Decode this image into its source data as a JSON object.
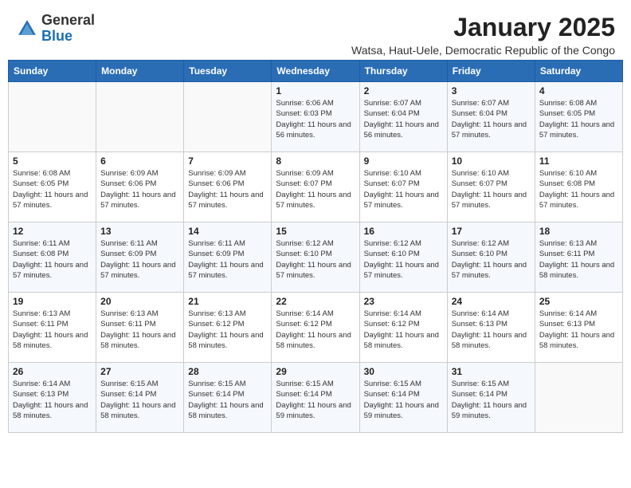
{
  "header": {
    "logo_general": "General",
    "logo_blue": "Blue",
    "title": "January 2025",
    "subtitle": "Watsa, Haut-Uele, Democratic Republic of the Congo"
  },
  "weekdays": [
    "Sunday",
    "Monday",
    "Tuesday",
    "Wednesday",
    "Thursday",
    "Friday",
    "Saturday"
  ],
  "weeks": [
    [
      {
        "day": "",
        "info": ""
      },
      {
        "day": "",
        "info": ""
      },
      {
        "day": "",
        "info": ""
      },
      {
        "day": "1",
        "info": "Sunrise: 6:06 AM\nSunset: 6:03 PM\nDaylight: 11 hours and 56 minutes."
      },
      {
        "day": "2",
        "info": "Sunrise: 6:07 AM\nSunset: 6:04 PM\nDaylight: 11 hours and 56 minutes."
      },
      {
        "day": "3",
        "info": "Sunrise: 6:07 AM\nSunset: 6:04 PM\nDaylight: 11 hours and 57 minutes."
      },
      {
        "day": "4",
        "info": "Sunrise: 6:08 AM\nSunset: 6:05 PM\nDaylight: 11 hours and 57 minutes."
      }
    ],
    [
      {
        "day": "5",
        "info": "Sunrise: 6:08 AM\nSunset: 6:05 PM\nDaylight: 11 hours and 57 minutes."
      },
      {
        "day": "6",
        "info": "Sunrise: 6:09 AM\nSunset: 6:06 PM\nDaylight: 11 hours and 57 minutes."
      },
      {
        "day": "7",
        "info": "Sunrise: 6:09 AM\nSunset: 6:06 PM\nDaylight: 11 hours and 57 minutes."
      },
      {
        "day": "8",
        "info": "Sunrise: 6:09 AM\nSunset: 6:07 PM\nDaylight: 11 hours and 57 minutes."
      },
      {
        "day": "9",
        "info": "Sunrise: 6:10 AM\nSunset: 6:07 PM\nDaylight: 11 hours and 57 minutes."
      },
      {
        "day": "10",
        "info": "Sunrise: 6:10 AM\nSunset: 6:07 PM\nDaylight: 11 hours and 57 minutes."
      },
      {
        "day": "11",
        "info": "Sunrise: 6:10 AM\nSunset: 6:08 PM\nDaylight: 11 hours and 57 minutes."
      }
    ],
    [
      {
        "day": "12",
        "info": "Sunrise: 6:11 AM\nSunset: 6:08 PM\nDaylight: 11 hours and 57 minutes."
      },
      {
        "day": "13",
        "info": "Sunrise: 6:11 AM\nSunset: 6:09 PM\nDaylight: 11 hours and 57 minutes."
      },
      {
        "day": "14",
        "info": "Sunrise: 6:11 AM\nSunset: 6:09 PM\nDaylight: 11 hours and 57 minutes."
      },
      {
        "day": "15",
        "info": "Sunrise: 6:12 AM\nSunset: 6:10 PM\nDaylight: 11 hours and 57 minutes."
      },
      {
        "day": "16",
        "info": "Sunrise: 6:12 AM\nSunset: 6:10 PM\nDaylight: 11 hours and 57 minutes."
      },
      {
        "day": "17",
        "info": "Sunrise: 6:12 AM\nSunset: 6:10 PM\nDaylight: 11 hours and 57 minutes."
      },
      {
        "day": "18",
        "info": "Sunrise: 6:13 AM\nSunset: 6:11 PM\nDaylight: 11 hours and 58 minutes."
      }
    ],
    [
      {
        "day": "19",
        "info": "Sunrise: 6:13 AM\nSunset: 6:11 PM\nDaylight: 11 hours and 58 minutes."
      },
      {
        "day": "20",
        "info": "Sunrise: 6:13 AM\nSunset: 6:11 PM\nDaylight: 11 hours and 58 minutes."
      },
      {
        "day": "21",
        "info": "Sunrise: 6:13 AM\nSunset: 6:12 PM\nDaylight: 11 hours and 58 minutes."
      },
      {
        "day": "22",
        "info": "Sunrise: 6:14 AM\nSunset: 6:12 PM\nDaylight: 11 hours and 58 minutes."
      },
      {
        "day": "23",
        "info": "Sunrise: 6:14 AM\nSunset: 6:12 PM\nDaylight: 11 hours and 58 minutes."
      },
      {
        "day": "24",
        "info": "Sunrise: 6:14 AM\nSunset: 6:13 PM\nDaylight: 11 hours and 58 minutes."
      },
      {
        "day": "25",
        "info": "Sunrise: 6:14 AM\nSunset: 6:13 PM\nDaylight: 11 hours and 58 minutes."
      }
    ],
    [
      {
        "day": "26",
        "info": "Sunrise: 6:14 AM\nSunset: 6:13 PM\nDaylight: 11 hours and 58 minutes."
      },
      {
        "day": "27",
        "info": "Sunrise: 6:15 AM\nSunset: 6:14 PM\nDaylight: 11 hours and 58 minutes."
      },
      {
        "day": "28",
        "info": "Sunrise: 6:15 AM\nSunset: 6:14 PM\nDaylight: 11 hours and 58 minutes."
      },
      {
        "day": "29",
        "info": "Sunrise: 6:15 AM\nSunset: 6:14 PM\nDaylight: 11 hours and 59 minutes."
      },
      {
        "day": "30",
        "info": "Sunrise: 6:15 AM\nSunset: 6:14 PM\nDaylight: 11 hours and 59 minutes."
      },
      {
        "day": "31",
        "info": "Sunrise: 6:15 AM\nSunset: 6:14 PM\nDaylight: 11 hours and 59 minutes."
      },
      {
        "day": "",
        "info": ""
      }
    ]
  ]
}
